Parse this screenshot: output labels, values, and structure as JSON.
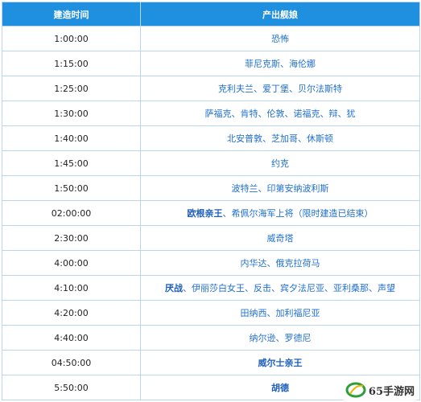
{
  "table": {
    "headers": [
      "建造时间",
      "产出舰娘"
    ],
    "rows": [
      {
        "time": "1:00:00",
        "ships": "恐怖"
      },
      {
        "time": "1:15:00",
        "ships": "菲尼克斯、海伦娜"
      },
      {
        "time": "1:25:00",
        "ships": "克利夫兰、爱丁堡、贝尔法斯特"
      },
      {
        "time": "1:30:00",
        "ships": "萨福克、肯特、伦敦、诺福克、辩、犹"
      },
      {
        "time": "1:40:00",
        "ships": "北安普敦、芝加哥、休斯顿"
      },
      {
        "time": "1:45:00",
        "ships": "约克"
      },
      {
        "time": "1:50:00",
        "ships": "波特兰、印第安纳波利斯"
      },
      {
        "time": "02:00:00",
        "ships_bold": "欧根亲王",
        "ships": "、希佩尔海军上将（限时建造已结束）"
      },
      {
        "time": "2:30:00",
        "ships": "威奇塔"
      },
      {
        "time": "4:00:00",
        "ships": "内华达、俄克拉荷马"
      },
      {
        "time": "4:10:00",
        "ships_bold": "厌战",
        "ships": "、伊丽莎白女王、反击、宾夕法尼亚、亚利桑那、声望"
      },
      {
        "time": "4:20:00",
        "ships": "田纳西、加利福尼亚"
      },
      {
        "time": "4:40:00",
        "ships": "纳尔逊、罗德尼"
      },
      {
        "time": "04:50:00",
        "ships_bold": "威尔士亲王",
        "ships": ""
      },
      {
        "time": "5:50:00",
        "ships_bold": "胡德",
        "ships": ""
      }
    ]
  },
  "watermark": {
    "text": "65手游网"
  }
}
